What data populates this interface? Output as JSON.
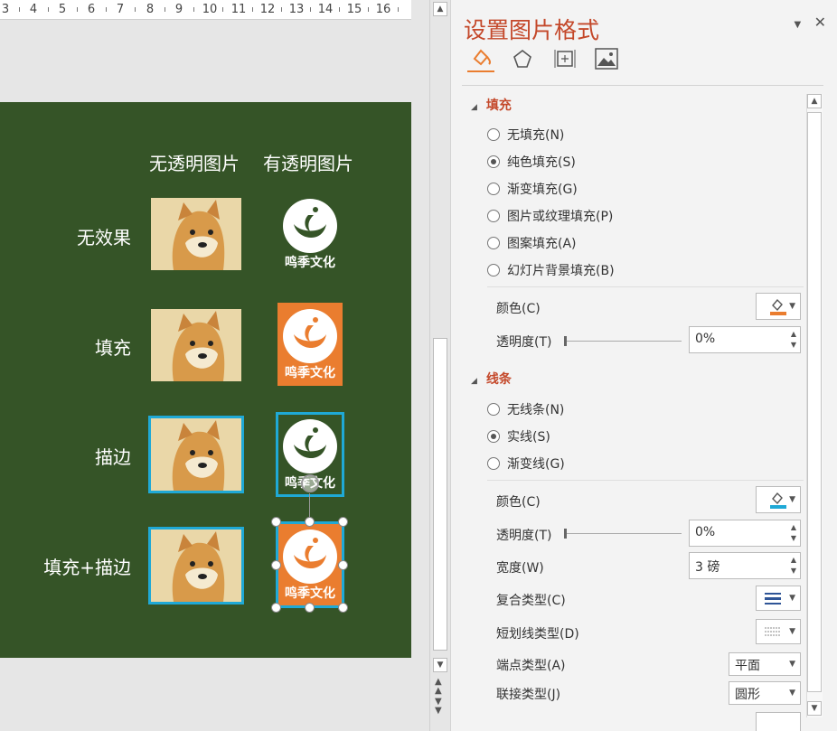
{
  "ruler": {
    "labels": [
      "3",
      "4",
      "5",
      "6",
      "7",
      "8",
      "9",
      "10",
      "11",
      "12",
      "13",
      "14",
      "15",
      "16"
    ]
  },
  "slide": {
    "header_left": "无透明图片",
    "header_right": "有透明图片",
    "rows": [
      "无效果",
      "填充",
      "描边",
      "填充+描边"
    ],
    "logo_text": "鸣季文化"
  },
  "pane": {
    "title": "设置图片格式",
    "close": "✕",
    "dropdown": "▼",
    "tabs": [
      "fill-line-icon",
      "effects-pentagon-icon",
      "size-properties-icon",
      "picture-icon"
    ],
    "fill": {
      "header": "填充",
      "options": [
        "无填充(N)",
        "纯色填充(S)",
        "渐变填充(G)",
        "图片或纹理填充(P)",
        "图案填充(A)",
        "幻灯片背景填充(B)"
      ],
      "selected": 1,
      "color_label": "颜色(C)",
      "color_swatch": "#ea7d2f",
      "transparency_label": "透明度(T)",
      "transparency_value": "0%"
    },
    "line": {
      "header": "线条",
      "options": [
        "无线条(N)",
        "实线(S)",
        "渐变线(G)"
      ],
      "selected": 1,
      "color_label": "颜色(C)",
      "color_swatch": "#1fa9d6",
      "transparency_label": "透明度(T)",
      "transparency_value": "0%",
      "width_label": "宽度(W)",
      "width_value": "3 磅",
      "compound_label": "复合类型(C)",
      "dash_label": "短划线类型(D)",
      "cap_label": "端点类型(A)",
      "cap_value": "平面",
      "join_label": "联接类型(J)",
      "join_value": "圆形"
    }
  }
}
